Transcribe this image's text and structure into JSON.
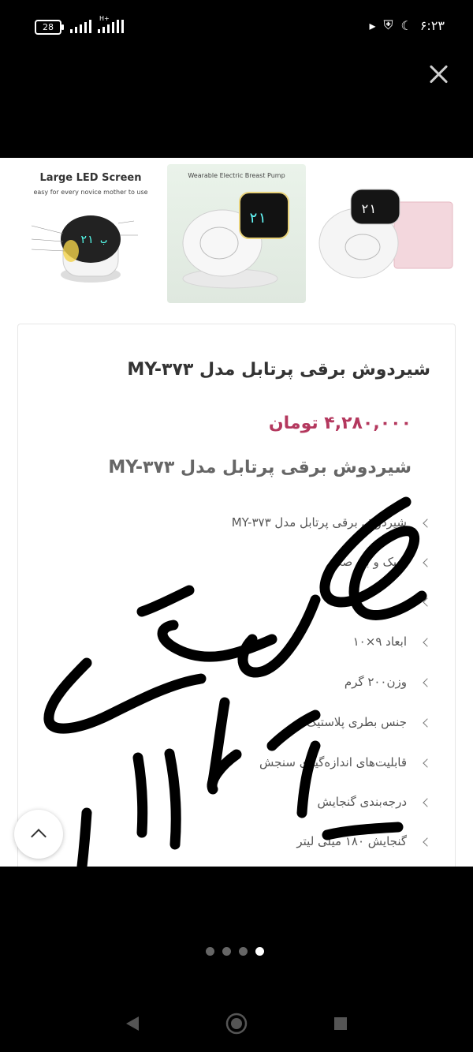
{
  "status_bar": {
    "battery": "28",
    "network": "H+",
    "time": "۶:۲۳",
    "icons": [
      "signal-icon",
      "play-icon",
      "shield-icon",
      "moon-icon"
    ]
  },
  "gallery": {
    "thumb1": {
      "title": "Large LED Screen",
      "subtitle": "easy for every novice mother to use"
    },
    "thumb2": {
      "title": "Wearable Electric Breast Pump"
    }
  },
  "product": {
    "title": "شیردوش برقی پرتابل مدل MY-۳۷۳",
    "price": "۴,۲۸۰,۰۰۰ تومان",
    "subtitle": "شیردوش برقی پرتابل مدل MY-۳۷۳",
    "features": [
      "شیردوش برقی پرتابل مدل MY-۳۷۳",
      "سبک و بی صدا",
      "",
      "ابعاد ۹×۱۰",
      "وزن۲۰۰ گرم",
      "جنس بطری پلاستیک",
      "قابلیت‌های اندازه‌گیری سنجش",
      "درجه‌بندی گنجایش",
      "گنجایش ۱۸۰ میلی لیتر"
    ],
    "price_color": "#b4385e"
  },
  "pager": {
    "total": 4,
    "active_index": 4
  }
}
